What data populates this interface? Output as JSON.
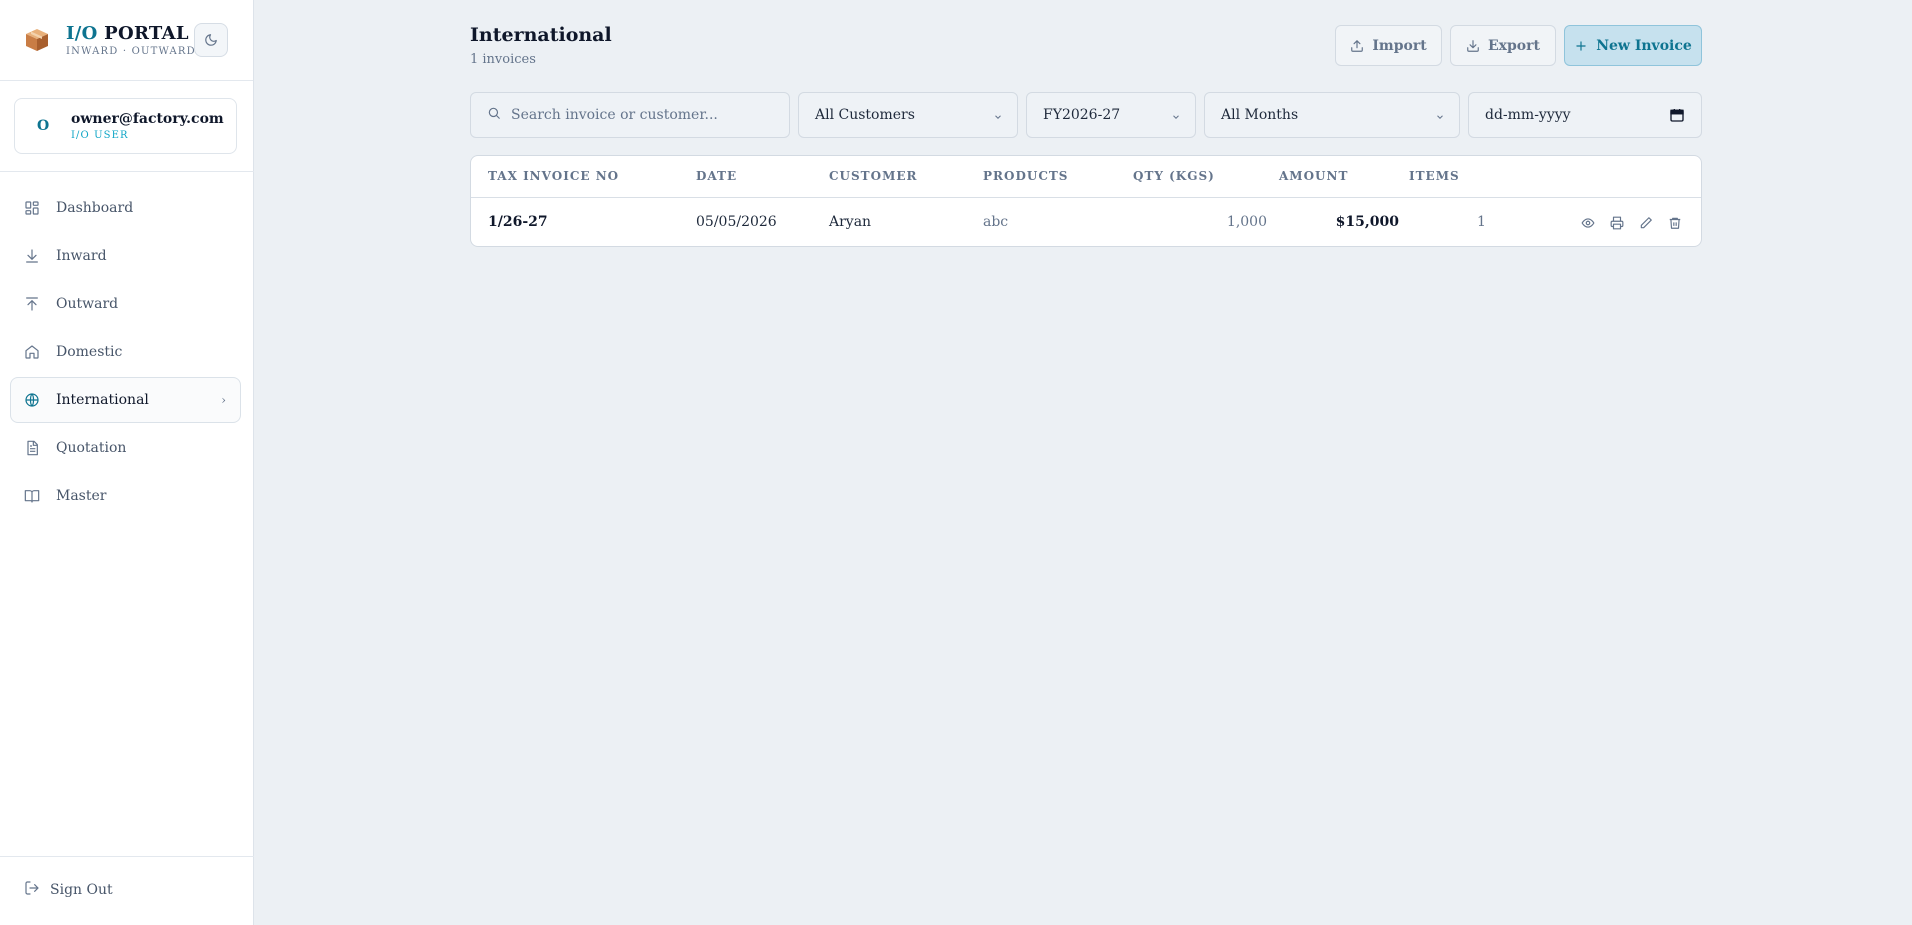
{
  "brand": {
    "title_prefix": "I/O",
    "title_suffix": " PORTAL",
    "subtitle": "INWARD · OUTWARD"
  },
  "user": {
    "initial": "O",
    "email": "owner@factory.com",
    "role": "I/O USER"
  },
  "sidebar": {
    "items": [
      {
        "label": "Dashboard",
        "icon": "dashboard-icon"
      },
      {
        "label": "Inward",
        "icon": "arrow-down-icon"
      },
      {
        "label": "Outward",
        "icon": "arrow-up-icon"
      },
      {
        "label": "Domestic",
        "icon": "home-icon"
      },
      {
        "label": "International",
        "icon": "globe-icon",
        "active": true
      },
      {
        "label": "Quotation",
        "icon": "document-icon"
      },
      {
        "label": "Master",
        "icon": "book-icon"
      }
    ],
    "sign_out": "Sign Out"
  },
  "header": {
    "title": "International",
    "subtitle": "1 invoices",
    "import_label": "Import",
    "export_label": "Export",
    "new_label": "New Invoice"
  },
  "filters": {
    "search_placeholder": "Search invoice or customer...",
    "customer": "All Customers",
    "fiscal_year": "FY2026-27",
    "month": "All Months",
    "date_placeholder": "dd-mm-yyyy"
  },
  "table": {
    "columns": [
      "TAX INVOICE NO",
      "DATE",
      "CUSTOMER",
      "PRODUCTS",
      "QTY (KGS)",
      "AMOUNT",
      "ITEMS"
    ],
    "rows": [
      {
        "invoice_no": "1/26-27",
        "date": "05/05/2026",
        "customer": "Aryan",
        "products": "abc",
        "qty": "1,000",
        "amount": "$15,000",
        "items": "1"
      }
    ]
  },
  "colors": {
    "accent": "#0e7490",
    "background": "#ecf0f4"
  }
}
